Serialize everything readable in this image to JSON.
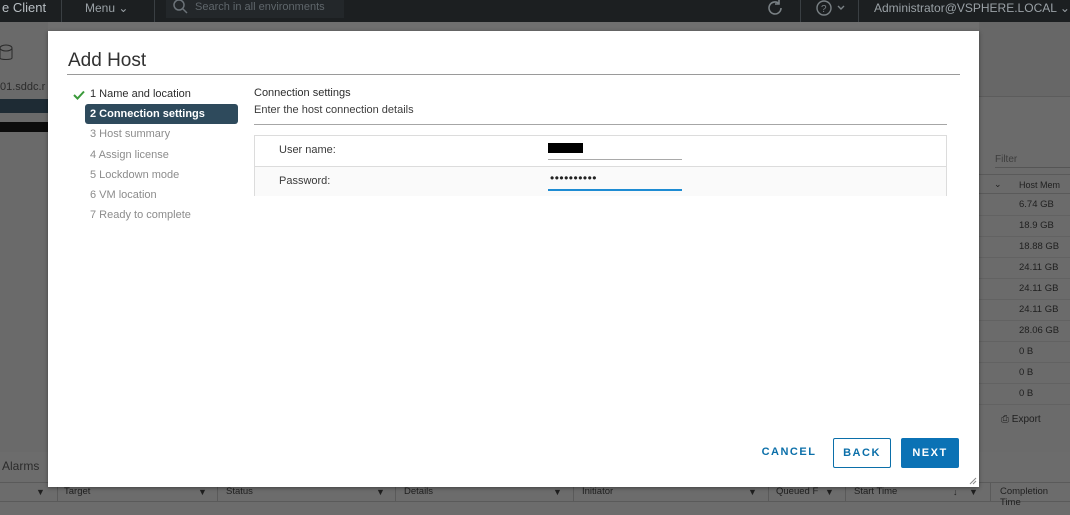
{
  "topbar": {
    "app_title": "e Client",
    "menu_label": "Menu",
    "search_placeholder": "Search in all environments",
    "user_label": "Administrator@VSPHERE.LOCAL"
  },
  "background": {
    "left_host": "01.sddc.r",
    "filter_placeholder": "Filter",
    "host_mem_header": "Host Mem",
    "host_mem_values": [
      "6.74 GB",
      "18.9 GB",
      "18.88 GB",
      "24.11 GB",
      "24.11 GB",
      "24.11 GB",
      "28.06 GB",
      "0 B",
      "0 B",
      "0 B"
    ],
    "export_label": "Export",
    "alarms_label": "Alarms",
    "task_columns": [
      "Target",
      "Status",
      "Details",
      "Initiator",
      "Queued F",
      "Start Time",
      "Completion Time"
    ]
  },
  "modal": {
    "title": "Add Host",
    "steps": [
      {
        "label": "1 Name and location",
        "state": "done"
      },
      {
        "label": "2 Connection settings",
        "state": "active"
      },
      {
        "label": "3 Host summary",
        "state": "pending"
      },
      {
        "label": "4 Assign license",
        "state": "pending"
      },
      {
        "label": "5 Lockdown mode",
        "state": "pending"
      },
      {
        "label": "6 VM location",
        "state": "pending"
      },
      {
        "label": "7 Ready to complete",
        "state": "pending"
      }
    ],
    "section_title": "Connection settings",
    "section_desc": "Enter the host connection details",
    "username_label": "User name:",
    "password_label": "Password:",
    "password_value": "••••••••••",
    "buttons": {
      "cancel": "CANCEL",
      "back": "BACK",
      "next": "NEXT"
    }
  },
  "colors": {
    "accent": "#0b72b5",
    "active_step": "#2e4a5c",
    "focus": "#1e8cd3",
    "check": "#3a9a3a"
  }
}
